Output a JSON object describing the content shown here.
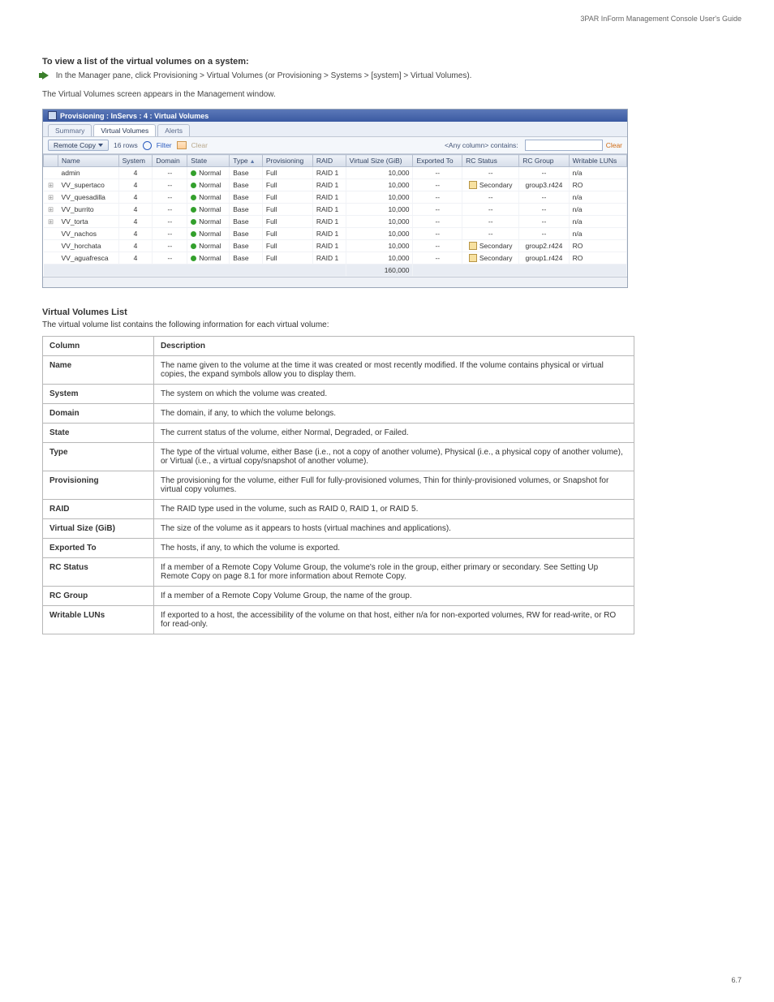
{
  "brand_note": "3PAR InForm Management Console User's Guide",
  "step": {
    "heading": "To view a list of the virtual volumes on a system:",
    "bullet": "In the Manager pane, click Provisioning > Virtual Volumes (or Provisioning > Systems > [system] > Virtual Volumes).",
    "result": "The Virtual Volumes screen appears in the Management window."
  },
  "titlebar": "Provisioning : InServs : 4 : Virtual Volumes",
  "tabs": [
    {
      "label": "Summary",
      "active": false
    },
    {
      "label": "Virtual Volumes",
      "active": true
    },
    {
      "label": "Alerts",
      "active": false
    }
  ],
  "toolbar": {
    "remote_copy": "Remote Copy",
    "row_count": "16 rows",
    "filter_label": "Filter",
    "clear_label": "Clear",
    "search_lead": "<Any column> contains:",
    "search_placeholder": "",
    "clear_link": "Clear"
  },
  "columns": {
    "expand": "",
    "name": "Name",
    "system": "System",
    "domain": "Domain",
    "state": "State",
    "type": "Type",
    "prov": "Provisioning",
    "raid": "RAID",
    "vsize": "Virtual Size (GiB)",
    "exported": "Exported To",
    "rcstatus": "RC Status",
    "rcgroup": "RC Group",
    "writable": "Writable LUNs"
  },
  "rows": [
    {
      "expand": "",
      "name": "admin",
      "system": "4",
      "domain": "--",
      "state": "Normal",
      "type": "Base",
      "prov": "Full",
      "raid": "RAID 1",
      "vsize": "10,000",
      "exported": "--",
      "rcstatus": "--",
      "rcgroup": "--",
      "writable": "n/a"
    },
    {
      "expand": "+",
      "name": "VV_supertaco",
      "system": "4",
      "domain": "--",
      "state": "Normal",
      "type": "Base",
      "prov": "Full",
      "raid": "RAID 1",
      "vsize": "10,000",
      "exported": "--",
      "rcstatus": "Secondary",
      "rcgroup": "group3.r424",
      "writable": "RO"
    },
    {
      "expand": "+",
      "name": "VV_quesadilla",
      "system": "4",
      "domain": "--",
      "state": "Normal",
      "type": "Base",
      "prov": "Full",
      "raid": "RAID 1",
      "vsize": "10,000",
      "exported": "--",
      "rcstatus": "--",
      "rcgroup": "--",
      "writable": "n/a"
    },
    {
      "expand": "+",
      "name": "VV_burrito",
      "system": "4",
      "domain": "--",
      "state": "Normal",
      "type": "Base",
      "prov": "Full",
      "raid": "RAID 1",
      "vsize": "10,000",
      "exported": "--",
      "rcstatus": "--",
      "rcgroup": "--",
      "writable": "n/a"
    },
    {
      "expand": "+",
      "name": "VV_torta",
      "system": "4",
      "domain": "--",
      "state": "Normal",
      "type": "Base",
      "prov": "Full",
      "raid": "RAID 1",
      "vsize": "10,000",
      "exported": "--",
      "rcstatus": "--",
      "rcgroup": "--",
      "writable": "n/a"
    },
    {
      "expand": "",
      "name": "VV_nachos",
      "system": "4",
      "domain": "--",
      "state": "Normal",
      "type": "Base",
      "prov": "Full",
      "raid": "RAID 1",
      "vsize": "10,000",
      "exported": "--",
      "rcstatus": "--",
      "rcgroup": "--",
      "writable": "n/a"
    },
    {
      "expand": "",
      "name": "VV_horchata",
      "system": "4",
      "domain": "--",
      "state": "Normal",
      "type": "Base",
      "prov": "Full",
      "raid": "RAID 1",
      "vsize": "10,000",
      "exported": "--",
      "rcstatus": "Secondary",
      "rcgroup": "group2.r424",
      "writable": "RO"
    },
    {
      "expand": "",
      "name": "VV_aguafresca",
      "system": "4",
      "domain": "--",
      "state": "Normal",
      "type": "Base",
      "prov": "Full",
      "raid": "RAID 1",
      "vsize": "10,000",
      "exported": "--",
      "rcstatus": "Secondary",
      "rcgroup": "group1.r424",
      "writable": "RO"
    }
  ],
  "total_vsize": "160,000",
  "info_heading": "Virtual Volumes List",
  "info_sub": "The virtual volume list contains the following information for each virtual volume:",
  "info_table": [
    {
      "col": "Name",
      "desc": "The name given to the volume at the time it was created or most recently modified. If the volume contains physical or virtual copies, the expand symbols allow you to display them."
    },
    {
      "col": "System",
      "desc": "The system on which the volume was created."
    },
    {
      "col": "Domain",
      "desc": "The domain, if any, to which the volume belongs."
    },
    {
      "col": "State",
      "desc": "The current status of the volume, either Normal, Degraded, or Failed."
    },
    {
      "col": "Type",
      "desc": "The type of the virtual volume, either Base (i.e., not a copy of another volume), Physical (i.e., a physical copy of another volume), or Virtual (i.e., a virtual copy/snapshot of another volume)."
    },
    {
      "col": "Provisioning",
      "desc": "The provisioning for the volume, either Full for fully-provisioned volumes, Thin for thinly-provisioned volumes, or Snapshot for virtual copy volumes."
    },
    {
      "col": "RAID",
      "desc": "The RAID type used in the volume, such as RAID 0, RAID 1, or RAID 5."
    },
    {
      "col": "Virtual Size (GiB)",
      "desc": "The size of the volume as it appears to hosts (virtual machines and applications)."
    },
    {
      "col": "Exported To",
      "desc": "The hosts, if any, to which the volume is exported."
    },
    {
      "col": "RC Status",
      "desc": "If a member of a Remote Copy Volume Group, the volume's role in the group, either primary or secondary. See Setting Up Remote Copy on page 8.1 for more information about Remote Copy."
    },
    {
      "col": "RC Group",
      "desc": "If a member of a Remote Copy Volume Group, the name of the group."
    },
    {
      "col": "Writable LUNs",
      "desc": "If exported to a host, the accessibility of the volume on that host, either n/a for non-exported volumes, RW for read-write, or RO for read-only."
    }
  ],
  "pagenum": "6.7"
}
